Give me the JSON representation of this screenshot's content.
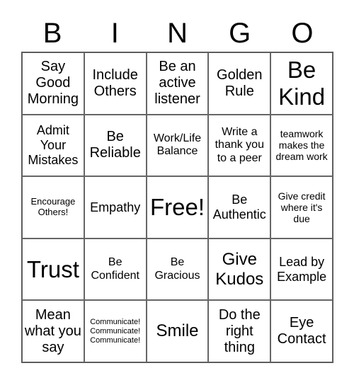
{
  "header": [
    "B",
    "I",
    "N",
    "G",
    "O"
  ],
  "cells": [
    "Say Good Morning",
    "Include Others",
    "Be an active listener",
    "Golden Rule",
    "Be Kind",
    "Admit Your Mistakes",
    "Be Reliable",
    "Work/Life Balance",
    "Write a thank you to a peer",
    "teamwork makes the dream work",
    "Encourage Others!",
    "Empathy",
    "Free!",
    "Be Authentic",
    "Give credit where it's due",
    "Trust",
    "Be Confident",
    "Be Gracious",
    "Give Kudos",
    "Lead by Example",
    "Mean what you say",
    "Communicate! Communicate! Communicate!",
    "Smile",
    "Do the right thing",
    "Eye Contact"
  ]
}
